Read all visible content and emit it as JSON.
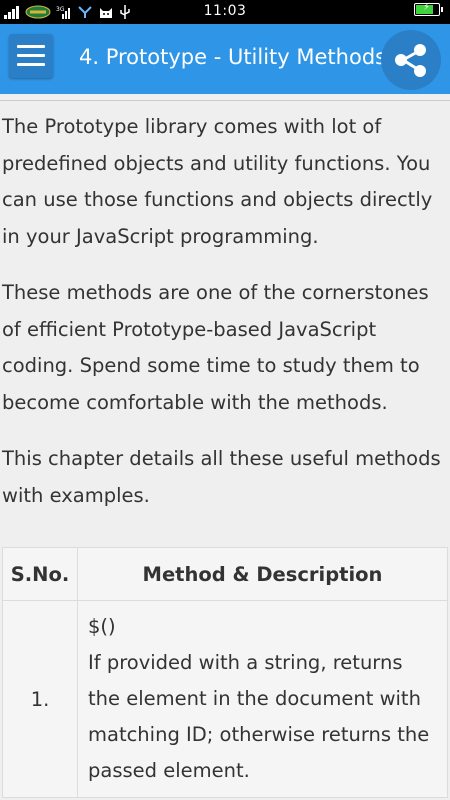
{
  "status_bar": {
    "time": "11:03",
    "carrier_label": "SMART GOLD",
    "battery_level": 0.8,
    "battery_color": "#3dd33d"
  },
  "app_bar": {
    "menu_icon": "hamburger-icon",
    "title": "4. Prototype - Utility Methods",
    "share_icon": "share-icon",
    "color": "#2f95e6"
  },
  "content": {
    "paragraphs": [
      "The Prototype library comes with lot of predefined objects and utility functions. You can use those functions and objects directly in your JavaScript programming.",
      "These methods are one of the cornerstones of efficient Prototype-based JavaScript coding. Spend some time to study them to become comfortable with the methods.",
      "This chapter details all these useful methods with examples."
    ],
    "table": {
      "headers": [
        "S.No.",
        "Method & Description"
      ],
      "rows": [
        {
          "sno": "1.",
          "method": "$()",
          "description": "If provided with a string, returns the element in the document with matching ID; otherwise returns the passed element."
        }
      ]
    }
  }
}
